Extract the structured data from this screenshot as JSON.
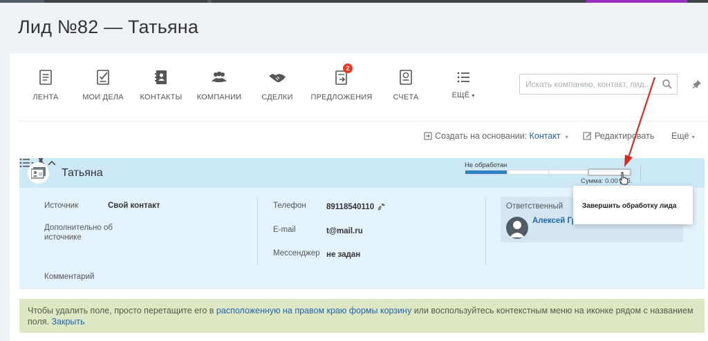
{
  "page": {
    "title": "Лид №82 — Татьяна"
  },
  "toolbar": {
    "items": [
      {
        "label": "ЛЕНТА",
        "icon": "feed-icon"
      },
      {
        "label": "МОИ ДЕЛА",
        "icon": "tasks-icon"
      },
      {
        "label": "КОНТАКТЫ",
        "icon": "contacts-icon"
      },
      {
        "label": "КОМПАНИИ",
        "icon": "companies-icon"
      },
      {
        "label": "СДЕЛКИ",
        "icon": "deals-icon"
      },
      {
        "label": "ПРЕДЛОЖЕНИЯ",
        "icon": "proposals-icon",
        "badge": "2"
      },
      {
        "label": "СЧЕТА",
        "icon": "invoices-icon"
      },
      {
        "label": "ЕЩЁ",
        "icon": "more-list-icon"
      }
    ],
    "search_placeholder": "Искать компанию, контакт, лид...",
    "more_caret": "▾"
  },
  "actions": {
    "create_based_label": "Создать на основании:",
    "create_based_value": "Контакт",
    "dropdown_caret": "▾",
    "edit_label": "Редактировать",
    "more_label": "Ещё"
  },
  "lead": {
    "name": "Татьяна",
    "status_label": "Не обработан",
    "status_progress_fraction": 0.25,
    "sum_label": "Сумма: 0.00 руб.",
    "fields": {
      "source_label": "Источник",
      "source_value": "Свой контакт",
      "source_extra_label": "Дополнительно об источнике",
      "comment_label": "Комментарий",
      "phone_label": "Телефон",
      "phone_value": "89118540110",
      "email_label": "E-mail",
      "email_value": "t@mail.ru",
      "messenger_label": "Мессенджер",
      "messenger_value": "не задан"
    },
    "responsible": {
      "label": "Ответственный",
      "name": "Алексей Григ"
    }
  },
  "popup": {
    "label": "Завершить обработку лида"
  },
  "hint": {
    "text_before": "Чтобы удалить поле, просто перетащите его в ",
    "link_text": "расположенную на правом краю формы корзину",
    "text_after": " или воспользуйтесь контекстным меню на иконке рядом с названием поля.",
    "close_link": "Закрыть"
  },
  "colors": {
    "accent_blue": "#2067b0",
    "progress_blue": "#2e82c7",
    "badge_red": "#f0371f",
    "arrow_red": "#d62a22",
    "panel_blue": "#e3f2fb",
    "hint_green": "#dde7c3"
  }
}
